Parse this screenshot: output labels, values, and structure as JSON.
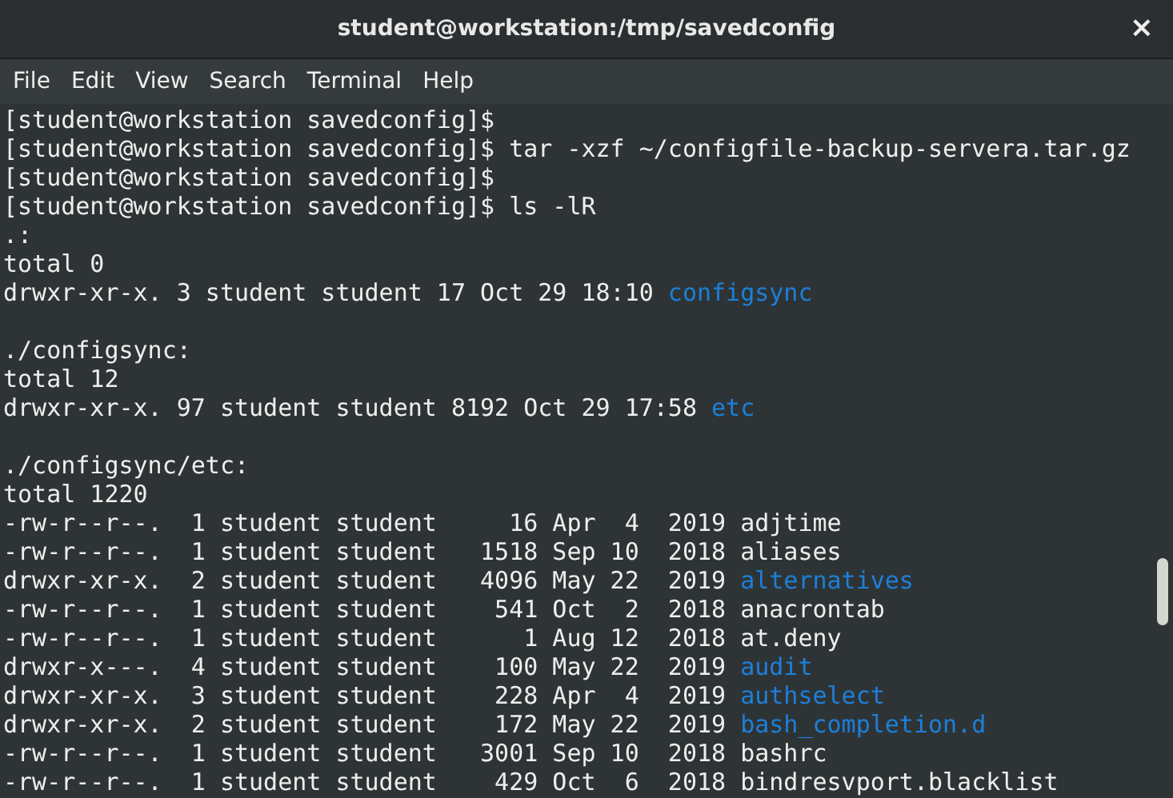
{
  "window": {
    "title": "student@workstation:/tmp/savedconfig",
    "close": "×"
  },
  "menu": [
    "File",
    "Edit",
    "View",
    "Search",
    "Terminal",
    "Help"
  ],
  "terminal": {
    "lines": [
      {
        "kind": "text",
        "text": "[student@workstation savedconfig]$"
      },
      {
        "kind": "text",
        "text": "[student@workstation savedconfig]$ tar -xzf ~/configfile-backup-servera.tar.gz"
      },
      {
        "kind": "text",
        "text": "[student@workstation savedconfig]$"
      },
      {
        "kind": "text",
        "text": "[student@workstation savedconfig]$ ls -lR"
      },
      {
        "kind": "text",
        "text": ".:"
      },
      {
        "kind": "text",
        "text": "total 0"
      },
      {
        "kind": "entry",
        "text": "drwxr-xr-x. 3 student student 17 Oct 29 18:10",
        "name": "configsync",
        "directory": true
      },
      {
        "kind": "blank"
      },
      {
        "kind": "text",
        "text": "./configsync:"
      },
      {
        "kind": "text",
        "text": "total 12"
      },
      {
        "kind": "entry",
        "text": "drwxr-xr-x. 97 student student 8192 Oct 29 17:58",
        "name": "etc",
        "directory": true
      },
      {
        "kind": "blank"
      },
      {
        "kind": "text",
        "text": "./configsync/etc:"
      },
      {
        "kind": "text",
        "text": "total 1220"
      },
      {
        "kind": "entry",
        "text": "-rw-r--r--.  1 student student     16 Apr  4  2019",
        "name": "adjtime",
        "directory": false
      },
      {
        "kind": "entry",
        "text": "-rw-r--r--.  1 student student   1518 Sep 10  2018",
        "name": "aliases",
        "directory": false
      },
      {
        "kind": "entry",
        "text": "drwxr-xr-x.  2 student student   4096 May 22  2019",
        "name": "alternatives",
        "directory": true
      },
      {
        "kind": "entry",
        "text": "-rw-r--r--.  1 student student    541 Oct  2  2018",
        "name": "anacrontab",
        "directory": false
      },
      {
        "kind": "entry",
        "text": "-rw-r--r--.  1 student student      1 Aug 12  2018",
        "name": "at.deny",
        "directory": false
      },
      {
        "kind": "entry",
        "text": "drwxr-x---.  4 student student    100 May 22  2019",
        "name": "audit",
        "directory": true
      },
      {
        "kind": "entry",
        "text": "drwxr-xr-x.  3 student student    228 Apr  4  2019",
        "name": "authselect",
        "directory": true
      },
      {
        "kind": "entry",
        "text": "drwxr-xr-x.  2 student student    172 May 22  2019",
        "name": "bash_completion.d",
        "directory": true
      },
      {
        "kind": "entry",
        "text": "-rw-r--r--.  1 student student   3001 Sep 10  2018",
        "name": "bashrc",
        "directory": false
      },
      {
        "kind": "entry",
        "text": "-rw-r--r--.  1 student student    429 Oct  6  2018",
        "name": "bindresvport.blacklist",
        "directory": false
      }
    ]
  }
}
